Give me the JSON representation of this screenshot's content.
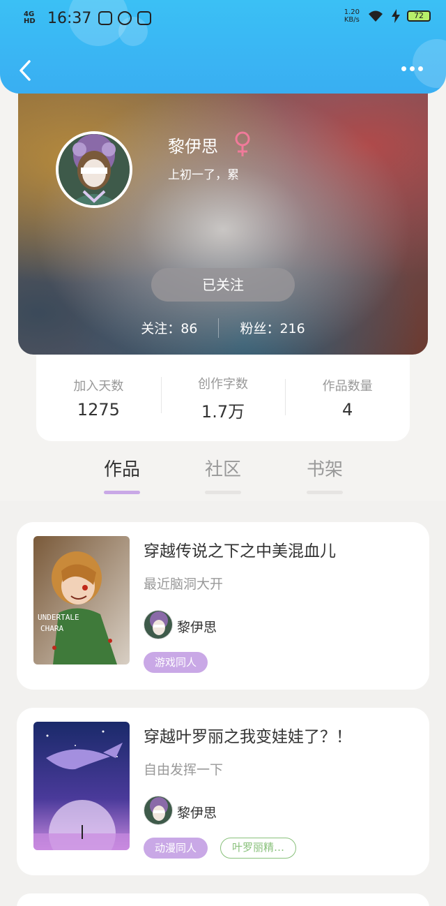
{
  "status_bar": {
    "network": "4G HD",
    "time": "16:37",
    "speed": "1.20",
    "speed_unit": "KB/s",
    "battery": "72"
  },
  "profile": {
    "name": "黎伊思",
    "bio": "上初一了，累",
    "follow_button": "已关注",
    "following_label": "关注：86",
    "fans_label": "粉丝：216"
  },
  "stats": [
    {
      "label": "加入天数",
      "value": "1275"
    },
    {
      "label": "创作字数",
      "value": "1.7万"
    },
    {
      "label": "作品数量",
      "value": "4"
    }
  ],
  "tabs": [
    "作品",
    "社区",
    "书架"
  ],
  "books": [
    {
      "title": "穿越传说之下之中美混血儿",
      "desc": "最近脑洞大开",
      "author": "黎伊思",
      "tags": [
        "游戏同人"
      ],
      "cover_text": "UNDERTALE\nCHARA"
    },
    {
      "title": "穿越叶罗丽之我变娃娃了？！",
      "desc": "自由发挥一下",
      "author": "黎伊思",
      "tags": [
        "动漫同人",
        "叶罗丽精…"
      ]
    }
  ],
  "colors": {
    "header": "#39aef2",
    "accent": "#c9a8e6",
    "tag_outline": "#88c07a",
    "female": "#f07a9a"
  }
}
